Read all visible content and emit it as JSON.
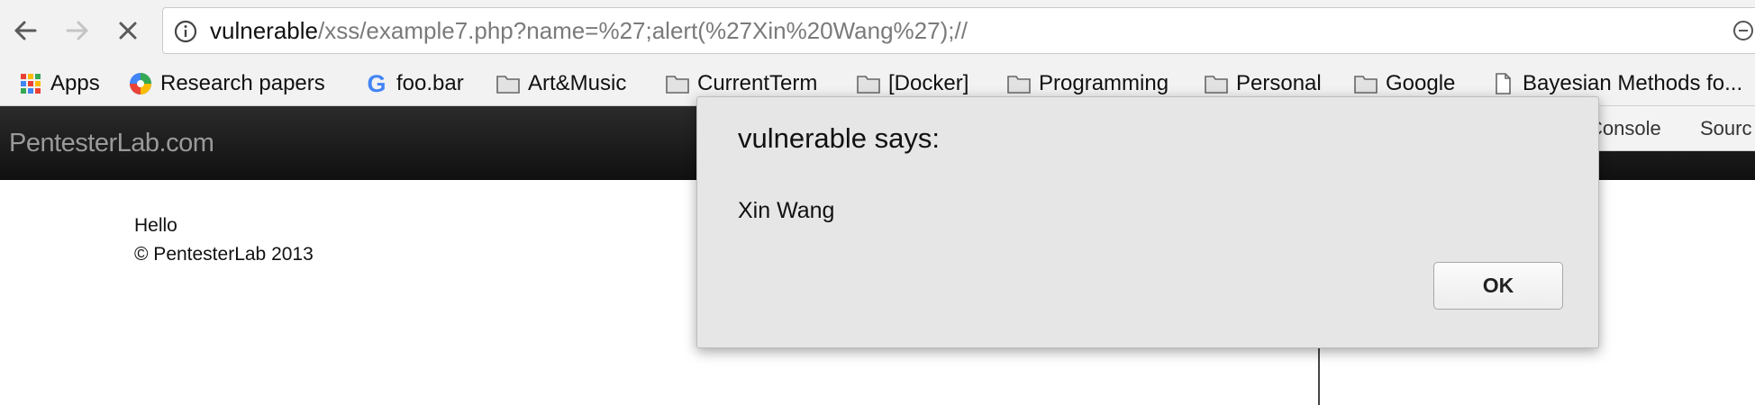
{
  "browser": {
    "url": {
      "host": "vulnerable",
      "path": "/xss/example7.php?name=%27;alert(%27Xin%20Wang%27);//"
    },
    "bookmarks": [
      {
        "label": "Apps",
        "icon": "apps-grid-icon"
      },
      {
        "label": "Research papers",
        "icon": "google-drive-icon"
      },
      {
        "label": "foo.bar",
        "icon": "google-g-icon"
      },
      {
        "label": "Art&Music",
        "icon": "folder-icon"
      },
      {
        "label": "CurrentTerm",
        "icon": "folder-icon"
      },
      {
        "label": "[Docker]",
        "icon": "folder-icon"
      },
      {
        "label": "Programming",
        "icon": "folder-icon"
      },
      {
        "label": "Personal",
        "icon": "folder-icon"
      },
      {
        "label": "Google",
        "icon": "folder-icon"
      },
      {
        "label": "Bayesian Methods fo...",
        "icon": "page-icon"
      }
    ]
  },
  "page": {
    "brand": "PentesterLab.com",
    "greeting": "Hello",
    "footer": "© PentesterLab 2013"
  },
  "devtools": {
    "tabs": [
      "Console",
      "Sourc"
    ]
  },
  "dialog": {
    "title": "vulnerable says:",
    "message": "Xin Wang",
    "ok_label": "OK"
  }
}
